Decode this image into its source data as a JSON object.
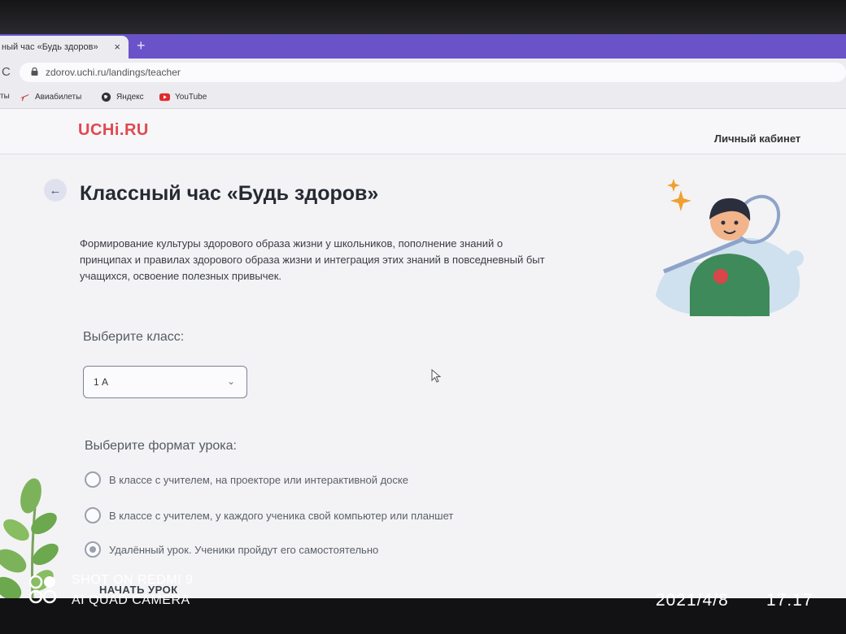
{
  "browser": {
    "tab_title": "ный час «Будь здоров»",
    "tab_close": "×",
    "new_tab": "+",
    "reload": "C",
    "url": "zdorov.uchi.ru/landings/teacher",
    "bookmarks": [
      {
        "label": "ты",
        "icon": "bookmark-partial"
      },
      {
        "label": "Авиабилеты",
        "icon": "plane-icon"
      },
      {
        "label": "Яндекс",
        "icon": "globe-icon"
      },
      {
        "label": "YouTube",
        "icon": "youtube-icon"
      }
    ]
  },
  "site": {
    "logo": "UCHi.RU",
    "cabinet": "Личный кабинет",
    "back_icon": "←",
    "title": "Классный час «Будь здоров»",
    "description": "Формирование культуры здорового образа жизни у школьников, пополнение знаний о принципах и правилах здорового образа жизни и интеграция этих знаний в повседневный быт учащихся, освоение полезных привычек.",
    "class_label": "Выберите класс:",
    "class_value": "1 А",
    "format_label": "Выберите формат урока:",
    "formats": [
      {
        "label": "В классе с учителем, на проекторе или интерактивной доске",
        "checked": false
      },
      {
        "label": "В классе с учителем, у каждого ученика свой компьютер или планшет",
        "checked": false
      },
      {
        "label": "Удалённый урок. Ученики пройдут его самостоятельно",
        "checked": true
      }
    ],
    "start_button": "НАЧАТЬ УРОК"
  },
  "watermark": {
    "line1": "SHOT ON REDMI 9",
    "line2": "AI QUAD CAMERA",
    "date": "2021/4/8",
    "time": "17:17"
  },
  "colors": {
    "tab_strip": "#6a52c9",
    "logo": "#e2484f",
    "page_bg": "#f3f3f5"
  }
}
